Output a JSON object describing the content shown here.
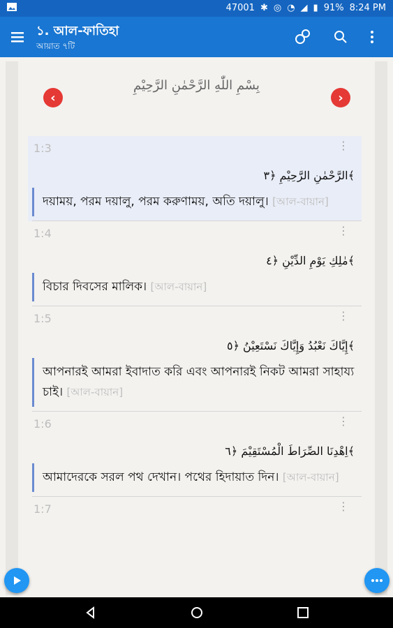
{
  "status": {
    "left_icon": "image-icon",
    "count": "47001",
    "battery": "91%",
    "time": "8:24 PM"
  },
  "toolbar": {
    "title": "১. আল-ফাতিহা",
    "subtitle": "আয়াত ৭টি"
  },
  "header": {
    "bismillah": "بِسْمِ اللّٰهِ الرَّحْمٰنِ الرَّحِيْمِ",
    "prev_glyph": "‹",
    "next_glyph": "›"
  },
  "verses": [
    {
      "number": "1:3",
      "arabic": "الرَّحْمٰنِ الرَّحِيْمِ ﴿٣﴾",
      "translation": "দয়াময়, পরম দয়ালু, পরম করুণাময়, অতি দয়ালু।",
      "source": "[আল-বায়ান]",
      "active": true
    },
    {
      "number": "1:4",
      "arabic": "مٰلِكِ يَوْمِ الدِّيْنِ ﴿٤﴾",
      "translation": "বিচার দিবসের মালিক।",
      "source": "[আল-বায়ান]",
      "active": false
    },
    {
      "number": "1:5",
      "arabic": "إِيَّاكَ نَعْبُدُ وَإِيَّاكَ نَسْتَعِيْنُ ﴿٥﴾",
      "translation": "আপনারই আমরা ইবাদাত করি এবং আপনারই নিকট আমরা সাহায্য চাই।",
      "source": "[আল-বায়ান]",
      "active": false
    },
    {
      "number": "1:6",
      "arabic": "اِهْدِنَا الصِّرَاطَ الْمُسْتَقِيْمَ ﴿٦﴾",
      "translation": "আমাদেরকে সরল পথ দেখান। পথের হিদায়াত দিন।",
      "source": "[আল-বায়ান]",
      "active": false
    },
    {
      "number": "1:7",
      "arabic": "",
      "translation": "",
      "source": "",
      "active": false
    }
  ],
  "colors": {
    "statusbar": "#1565c0",
    "toolbar": "#1976d2",
    "accent": "#e53935",
    "fab": "#2196f3"
  }
}
